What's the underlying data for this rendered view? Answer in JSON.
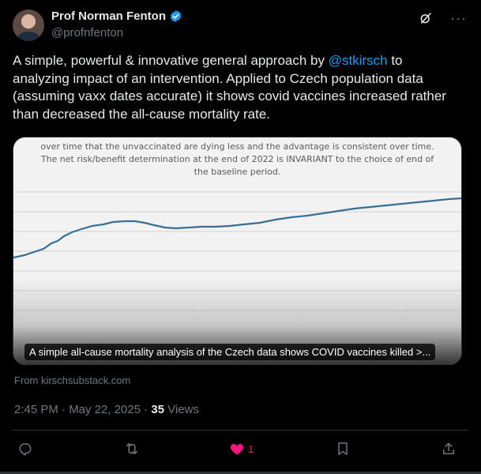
{
  "author": {
    "name": "Prof Norman Fenton",
    "handle": "@profnfenton"
  },
  "tweet": {
    "text_before_mention": "A simple, powerful & innovative general approach by ",
    "mention": "@stkirsch",
    "text_after_mention": " to analyzing impact of an intervention. Applied to Czech population data (assuming vaxx dates accurate) it shows covid vaccines increased rather than decreased the all-cause mortality rate."
  },
  "card": {
    "caption": "over time that the unvaccinated are dying less and the advantage is consistent over time. The net risk/benefit determination at the end of 2022 is INVARIANT to the choice of end of the baseline period.",
    "title": "A simple all-cause mortality analysis of the Czech data shows COVID vaccines killed >...",
    "source": "From kirschsubstack.com",
    "line_color": "#3a6f95"
  },
  "meta": {
    "time_date": "2:45 PM · May 22, 2025 · ",
    "views_count": "35",
    "views_label": " Views"
  },
  "actions": {
    "like_count": "1"
  },
  "icons": {
    "verified": "verified-badge-icon",
    "grok": "grok-icon",
    "more": "more-icon",
    "reply": "reply-icon",
    "repost": "repost-icon",
    "like": "heart-icon",
    "bookmark": "bookmark-icon",
    "share": "share-icon"
  }
}
